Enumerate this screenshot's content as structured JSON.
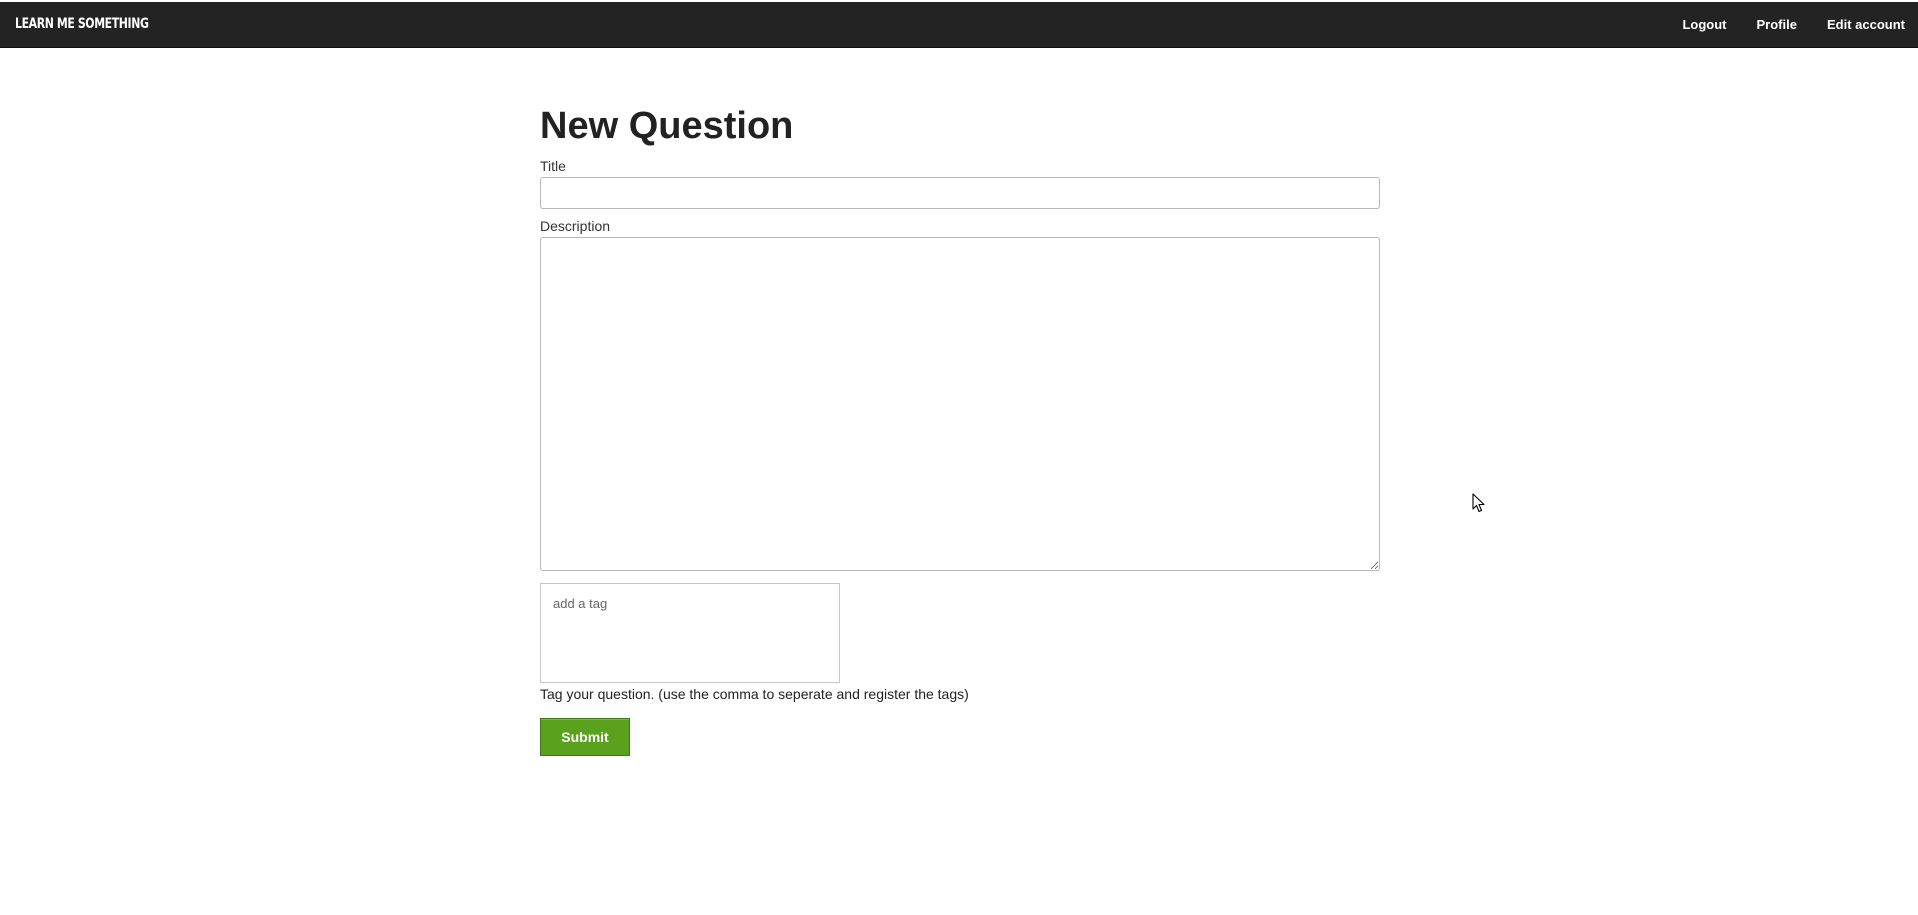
{
  "header": {
    "brand": "LEARN ME SOMETHING",
    "nav": {
      "logout": "Logout",
      "profile": "Profile",
      "edit_account": "Edit account"
    }
  },
  "form": {
    "heading": "New Question",
    "title_label": "Title",
    "title_value": "",
    "description_label": "Description",
    "description_value": "",
    "tag_placeholder": "add a tag",
    "tag_hint": "Tag your question. (use the comma to seperate and register the tags)",
    "submit_label": "Submit"
  },
  "colors": {
    "topbar": "#232323",
    "submit": "#5aa21e"
  },
  "icons": {
    "cursor": "mouse-pointer-icon"
  }
}
